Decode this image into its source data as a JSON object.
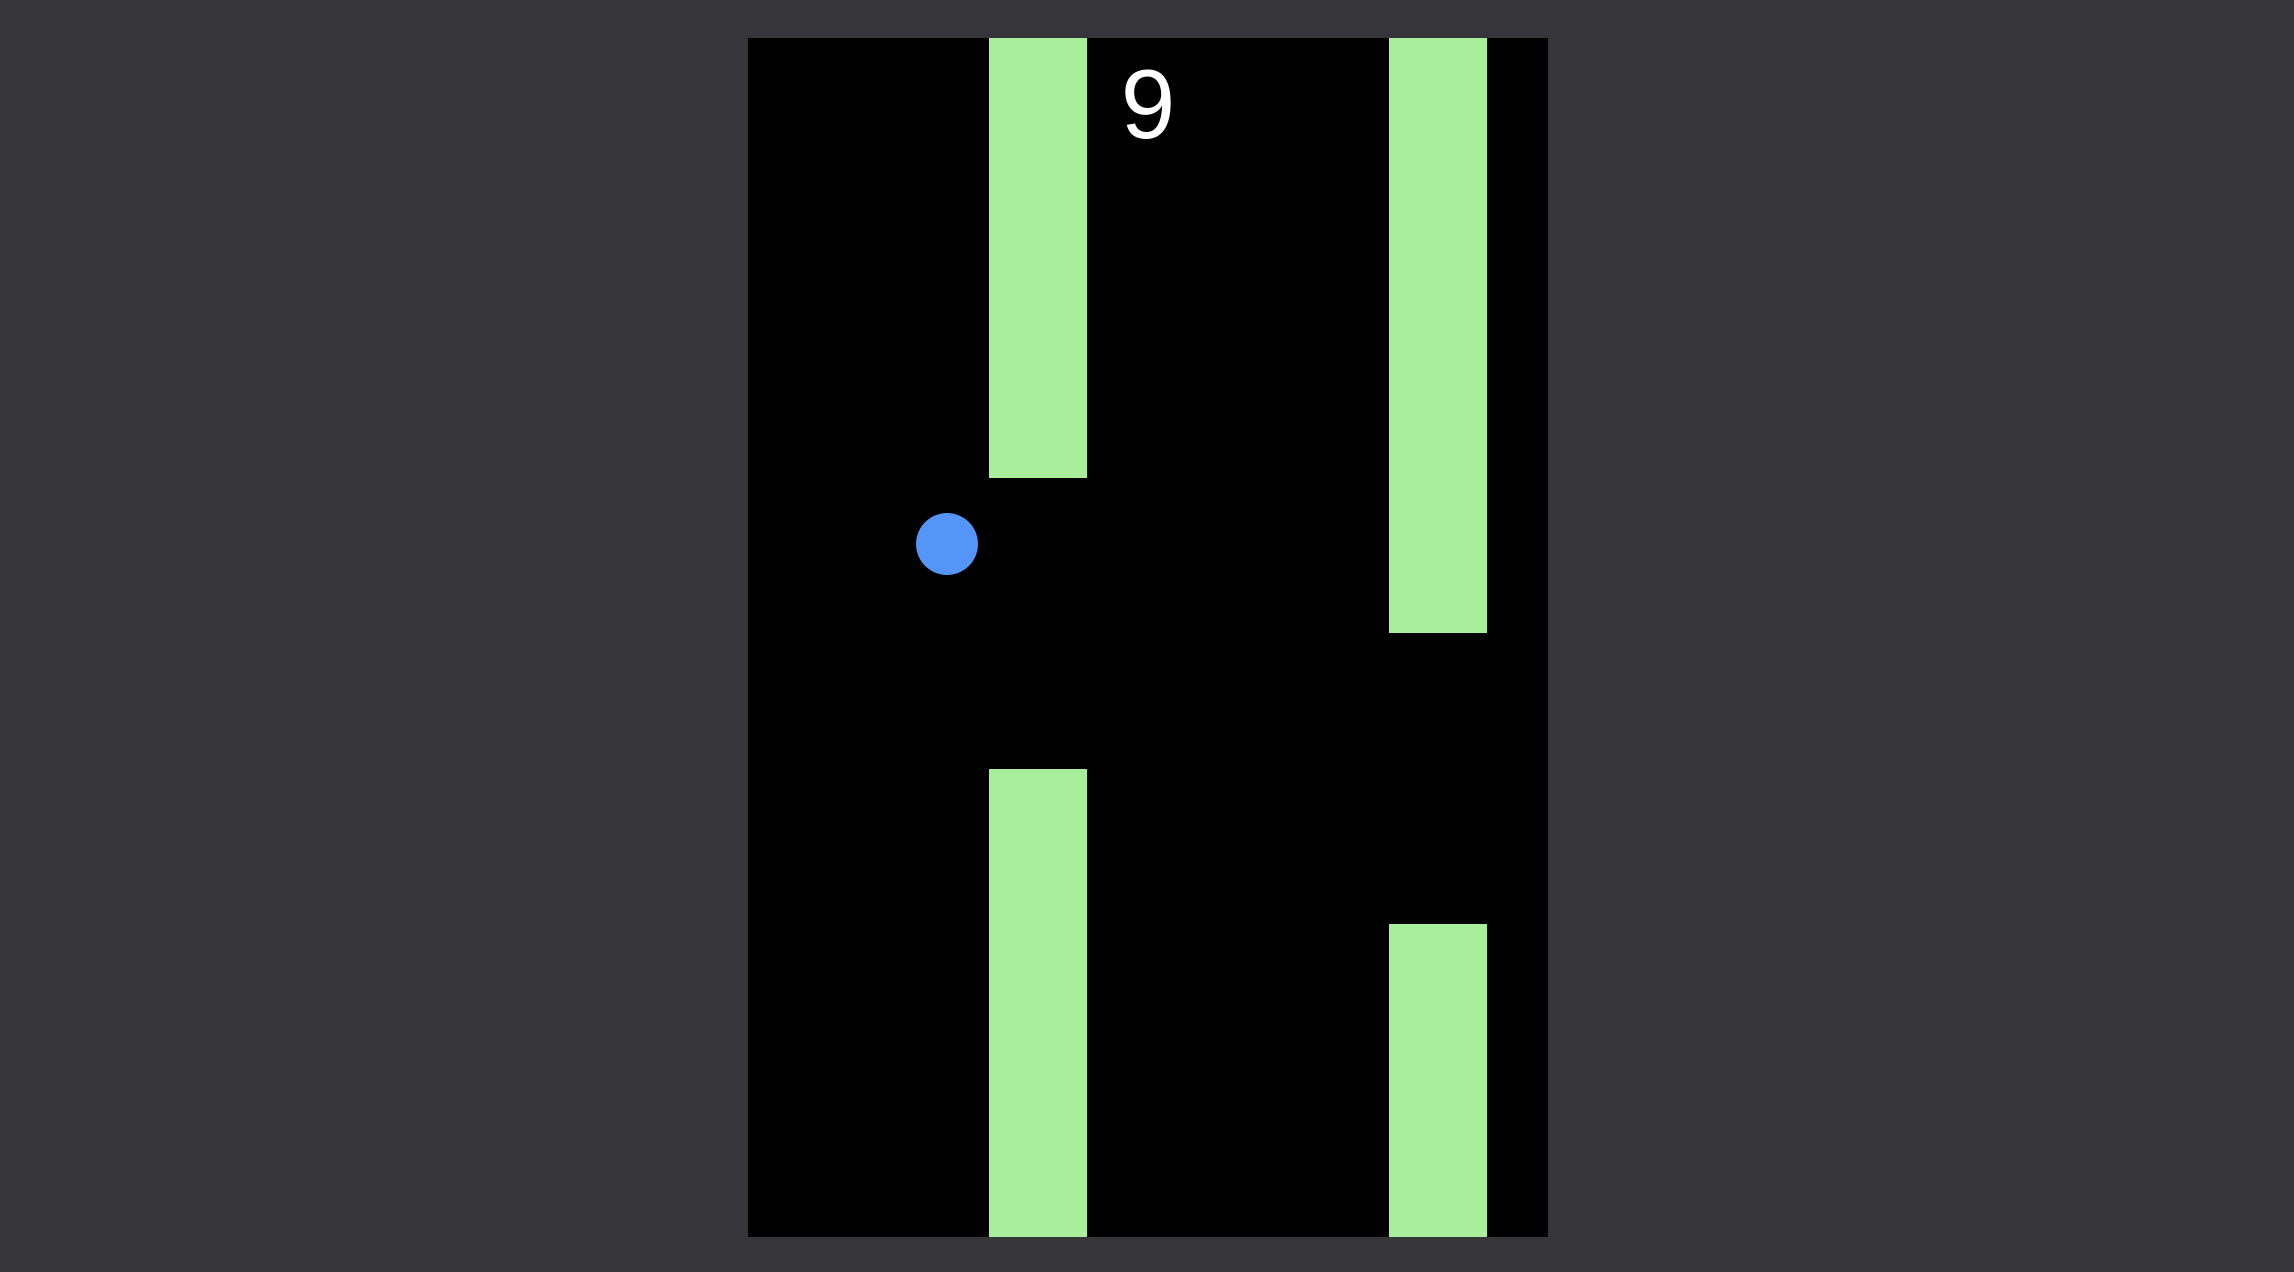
{
  "game": {
    "score": "9",
    "colors": {
      "page_background": "#36353a",
      "canvas_background": "#000000",
      "pipe": "#a9ee9a",
      "bird": "#5595f7",
      "score_text": "#ffffff"
    }
  }
}
